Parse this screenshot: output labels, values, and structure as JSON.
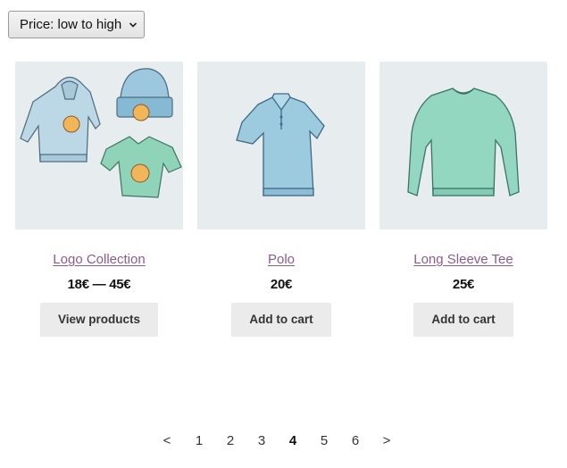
{
  "sort": {
    "selected": "Price: low to high"
  },
  "products": [
    {
      "title": "Logo Collection",
      "price": "18€ — 45€",
      "button": "View products",
      "image": "logo-collection-image"
    },
    {
      "title": "Polo",
      "price": "20€",
      "button": "Add to cart",
      "image": "polo-image"
    },
    {
      "title": "Long Sleeve Tee",
      "price": "25€",
      "button": "Add to cart",
      "image": "long-sleeve-tee-image"
    }
  ],
  "pagination": {
    "prev": "<",
    "pages": [
      "1",
      "2",
      "3",
      "4",
      "5",
      "6"
    ],
    "current": "4",
    "next": ">"
  },
  "colors": {
    "link": "#8d5a8e",
    "thumb_bg": "#e7ecef",
    "button_bg": "#ebebeb"
  }
}
